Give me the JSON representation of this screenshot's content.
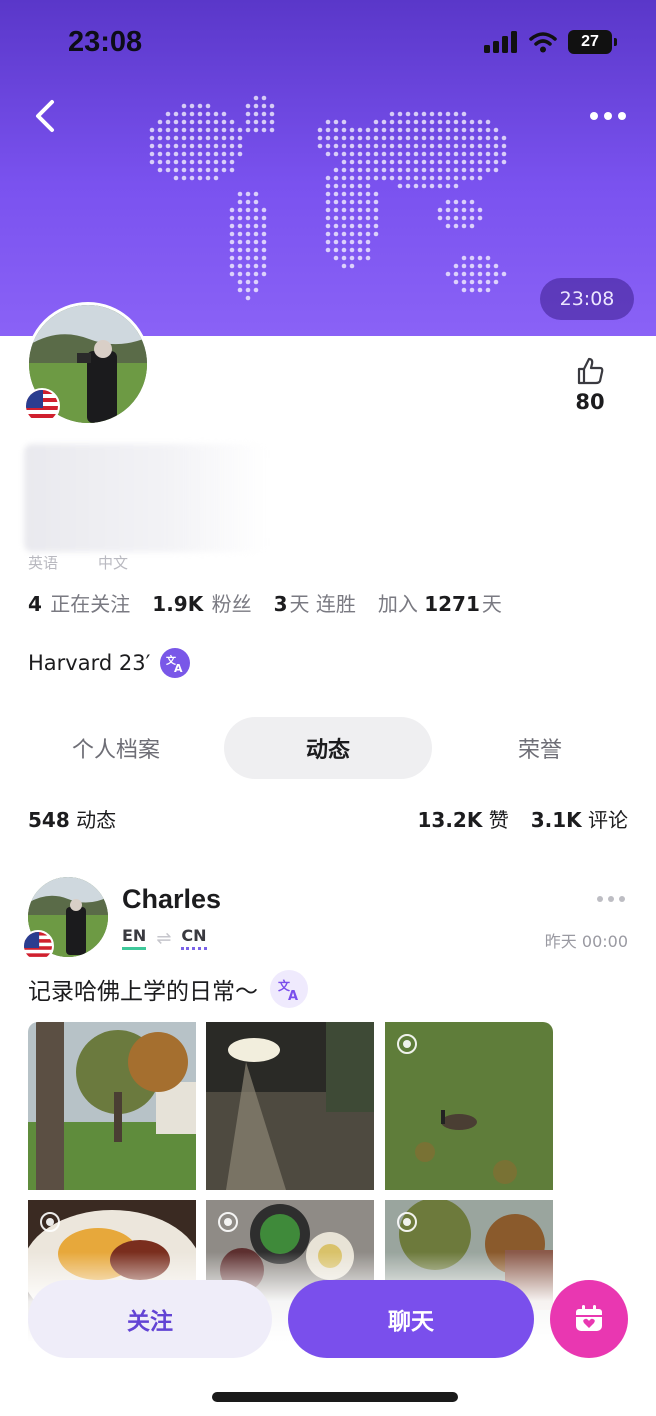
{
  "status_bar": {
    "time": "23:08",
    "battery": "27",
    "icons": [
      "signal-icon",
      "wifi-icon",
      "battery-icon"
    ]
  },
  "header": {
    "local_time": "23:08",
    "back_icon": "chevron-left-icon",
    "more_icon": "more-icon",
    "map": "world-map-dots"
  },
  "profile": {
    "likes": "80",
    "languages": [
      "英语",
      "中文"
    ],
    "stats": [
      {
        "value": "4",
        "label": "正在关注",
        "prefix": ""
      },
      {
        "value": "1.9K",
        "label": "粉丝",
        "prefix": ""
      },
      {
        "value": "3",
        "label": "天 连胜",
        "prefix": ""
      },
      {
        "value": "1271",
        "label": "天",
        "prefix": "加入"
      }
    ],
    "bio": "Harvard 23′"
  },
  "tabs": [
    {
      "label": "个人档案",
      "active": false
    },
    {
      "label": "动态",
      "active": true
    },
    {
      "label": "荣誉",
      "active": false
    }
  ],
  "counts": {
    "moments_value": "548",
    "moments_label": "动态",
    "likes_value": "13.2K",
    "likes_label": "赞",
    "comments_value": "3.1K",
    "comments_label": "评论"
  },
  "post": {
    "author": "Charles",
    "native_lang": "EN",
    "learning_lang": "CN",
    "time": "昨天 00:00",
    "text": "记录哈佛上学的日常～",
    "photos": [
      "campus-trees",
      "night-street",
      "goose-on-grass",
      "dinner-plate",
      "food-dishes",
      "autumn-trees"
    ]
  },
  "actions": {
    "follow_label": "关注",
    "chat_label": "聊天",
    "gift_icon": "calendar-heart-icon"
  },
  "colors": {
    "header_purple": "#7a52ef",
    "accent": "#7a4fec",
    "gift_pink": "#e937b1",
    "en_underline": "#3ec89a"
  }
}
